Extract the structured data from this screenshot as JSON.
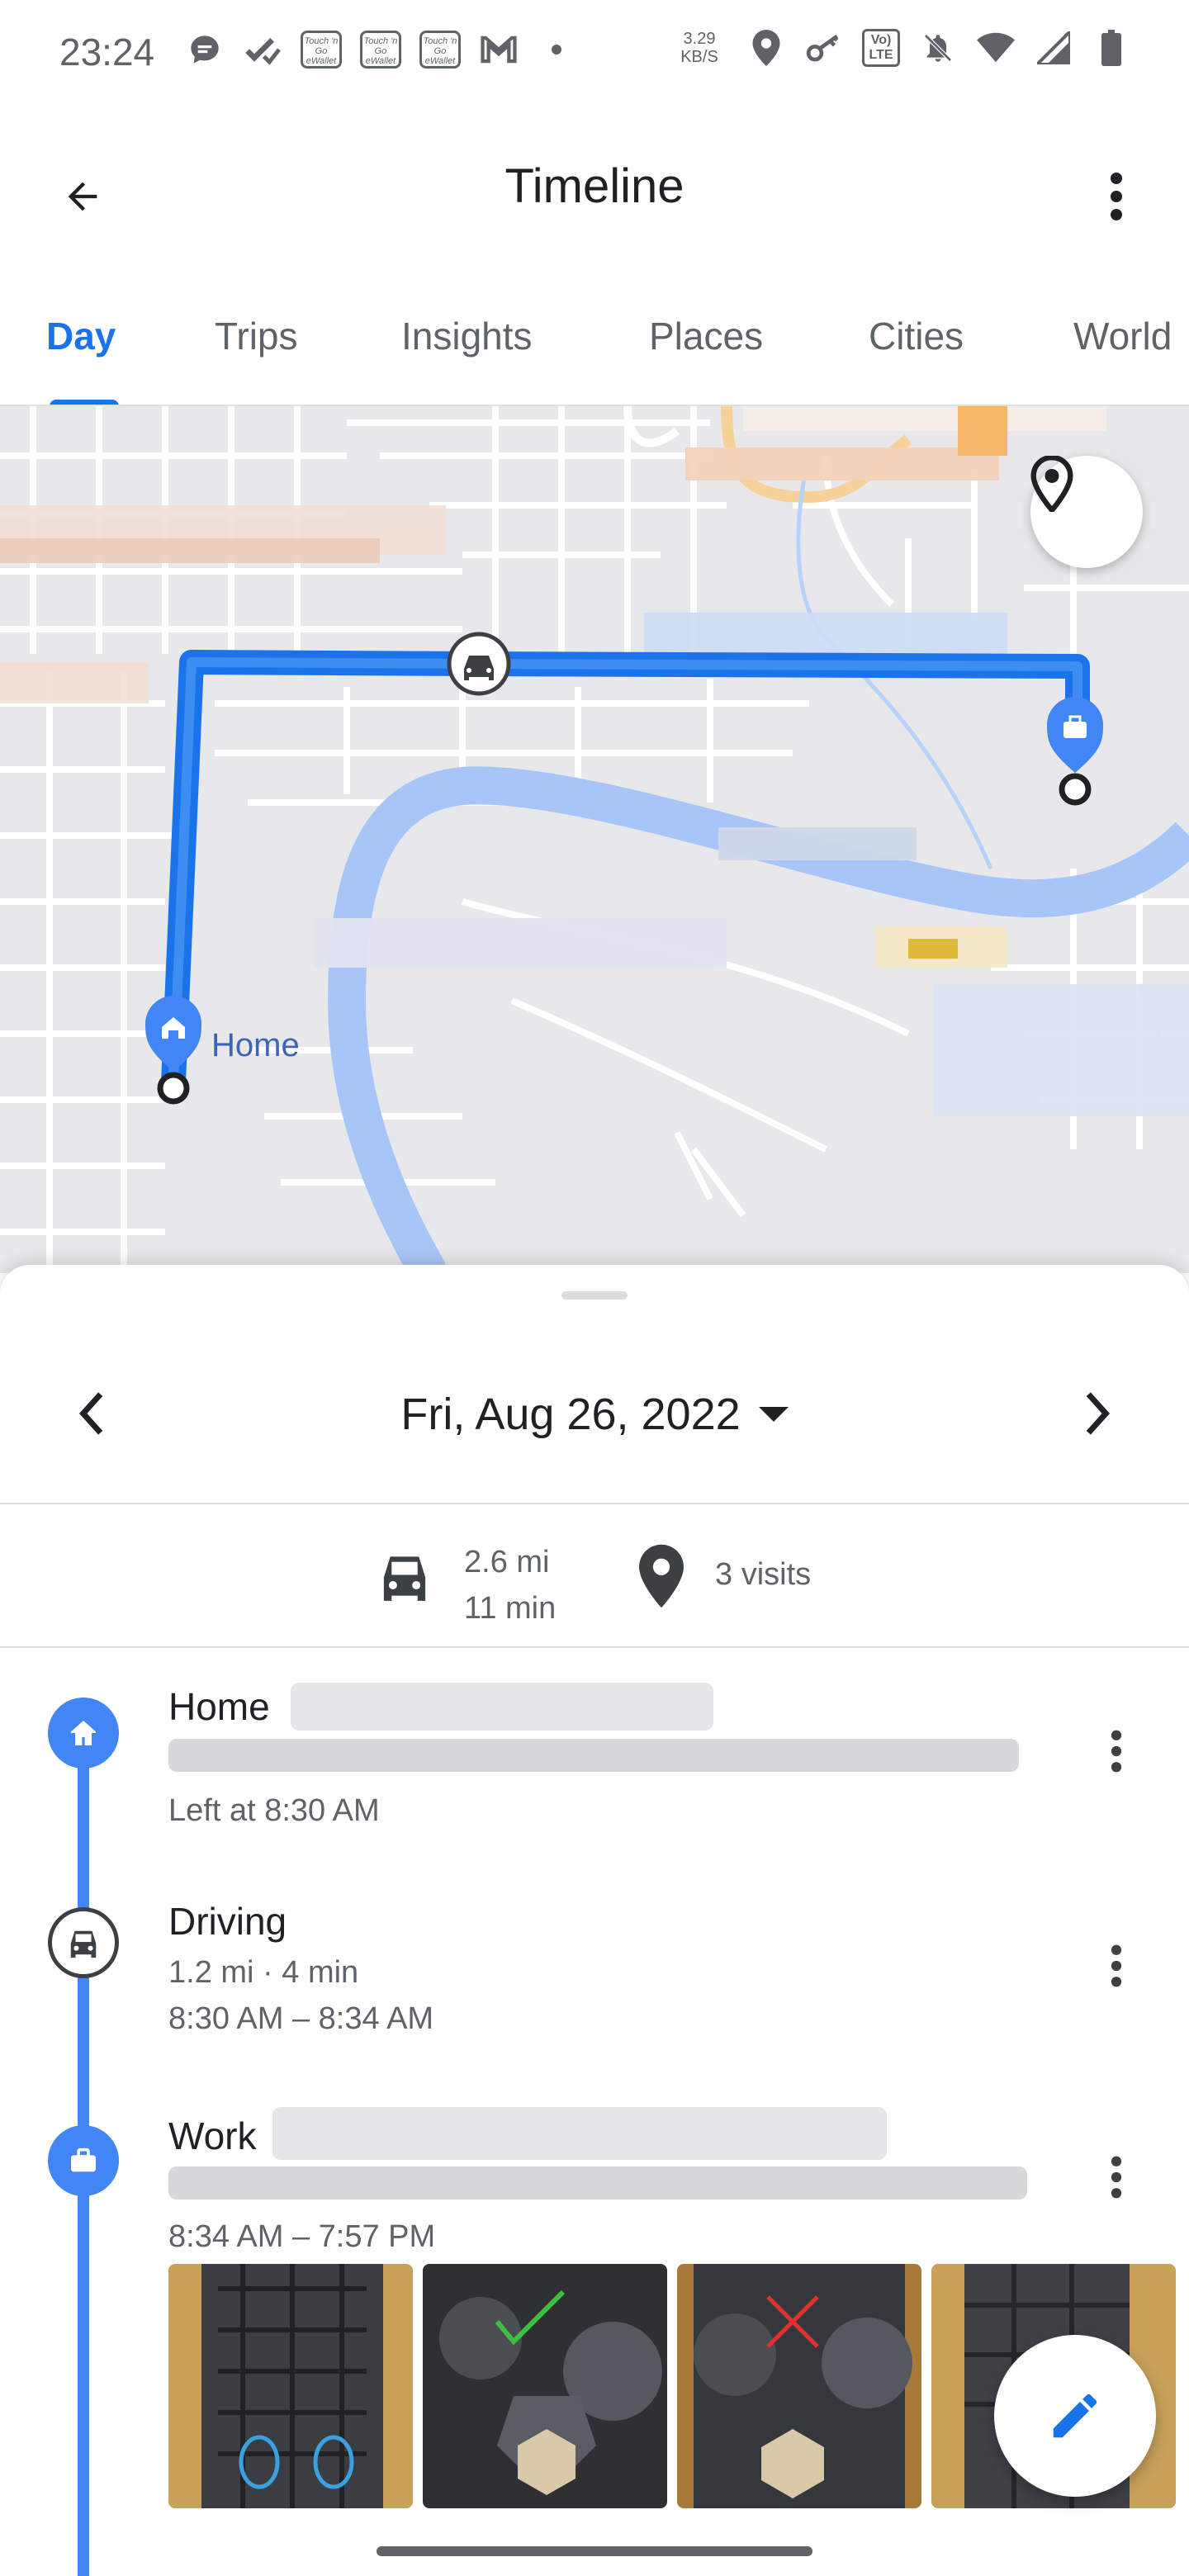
{
  "status_bar": {
    "time": "23:24",
    "badge_text": "Touch 'n Go eWallet",
    "net_speed": "3.29",
    "net_speed_unit": "KB/S",
    "lte": "Vo) LTE",
    "left_icons": [
      "chat-bubble-icon",
      "check-tools-icon",
      "touchngo-icon",
      "touchngo-icon",
      "touchngo-icon",
      "gmail-icon",
      "dot-icon"
    ],
    "right_icons": [
      "location-icon",
      "key-icon",
      "lte-icon",
      "bell-off-icon",
      "wifi-icon",
      "signal-icon",
      "battery-icon"
    ]
  },
  "app_bar": {
    "title": "Timeline",
    "back_icon": "arrow-back-icon",
    "menu_icon": "more-vert-icon"
  },
  "tabs": [
    {
      "label": "Day",
      "active": true
    },
    {
      "label": "Trips",
      "active": false
    },
    {
      "label": "Insights",
      "active": false
    },
    {
      "label": "Places",
      "active": false
    },
    {
      "label": "Cities",
      "active": false
    },
    {
      "label": "World",
      "active": false
    }
  ],
  "map": {
    "home_label": "Home",
    "route_color": "#1a73e8",
    "river_color": "#a7c6f7"
  },
  "date_nav": {
    "date": "Fri, Aug 26, 2022"
  },
  "summary": {
    "distance": "2.6 mi",
    "duration": "11 min",
    "visits": "3 visits"
  },
  "timeline": [
    {
      "title": "Home",
      "subtitle": "Left at 8:30 AM",
      "icon": "home-icon"
    },
    {
      "title": "Driving",
      "subtitle": "1.2 mi · 4 min",
      "subtitle2": "8:30 AM – 8:34 AM",
      "icon": "car-icon"
    },
    {
      "title": "Work",
      "subtitle": "8:34 AM – 7:57 PM",
      "icon": "briefcase-icon"
    }
  ],
  "colors": {
    "accent": "#1a73e8",
    "timeline_blue": "#4285f4",
    "text_primary": "#202124",
    "text_secondary": "#5f6368"
  }
}
